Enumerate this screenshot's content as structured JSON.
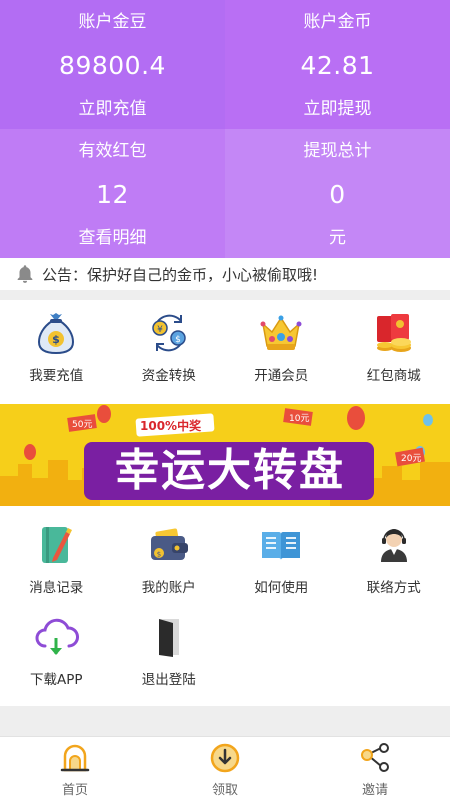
{
  "stats": [
    {
      "label": "账户金豆",
      "value": "89800.4",
      "action": "立即充值"
    },
    {
      "label": "账户金币",
      "value": "42.81",
      "action": "立即提现"
    },
    {
      "label": "有效红包",
      "value": "12",
      "action": "查看明细"
    },
    {
      "label": "提现总计",
      "value": "0",
      "action": "元"
    }
  ],
  "notice": {
    "text": "公告：保护好自己的金币，小心被偷取哦!"
  },
  "menu1": [
    {
      "label": "我要充值",
      "icon": "money-bag-icon"
    },
    {
      "label": "资金转换",
      "icon": "currency-exchange-icon"
    },
    {
      "label": "开通会员",
      "icon": "crown-icon"
    },
    {
      "label": "红包商城",
      "icon": "red-packet-icon"
    }
  ],
  "banner": {
    "title": "幸运大转盘",
    "badge": "100%中奖",
    "tag1": "50元",
    "tag2": "10元",
    "tag3": "20元"
  },
  "menu2": [
    {
      "label": "消息记录",
      "icon": "notebook-icon"
    },
    {
      "label": "我的账户",
      "icon": "wallet-icon"
    },
    {
      "label": "如何使用",
      "icon": "book-icon"
    },
    {
      "label": "联络方式",
      "icon": "customer-service-icon"
    },
    {
      "label": "下载APP",
      "icon": "cloud-download-icon"
    },
    {
      "label": "退出登陆",
      "icon": "logout-door-icon"
    }
  ],
  "tabbar": [
    {
      "label": "首页",
      "icon": "home-icon"
    },
    {
      "label": "领取",
      "icon": "claim-icon"
    },
    {
      "label": "邀请",
      "icon": "share-icon"
    }
  ],
  "colors": {
    "accent": "#b36df3",
    "tab_icon": "#f2a51c",
    "banner_bg": "#f6cf1a",
    "banner_title": "#7a1fa2"
  }
}
